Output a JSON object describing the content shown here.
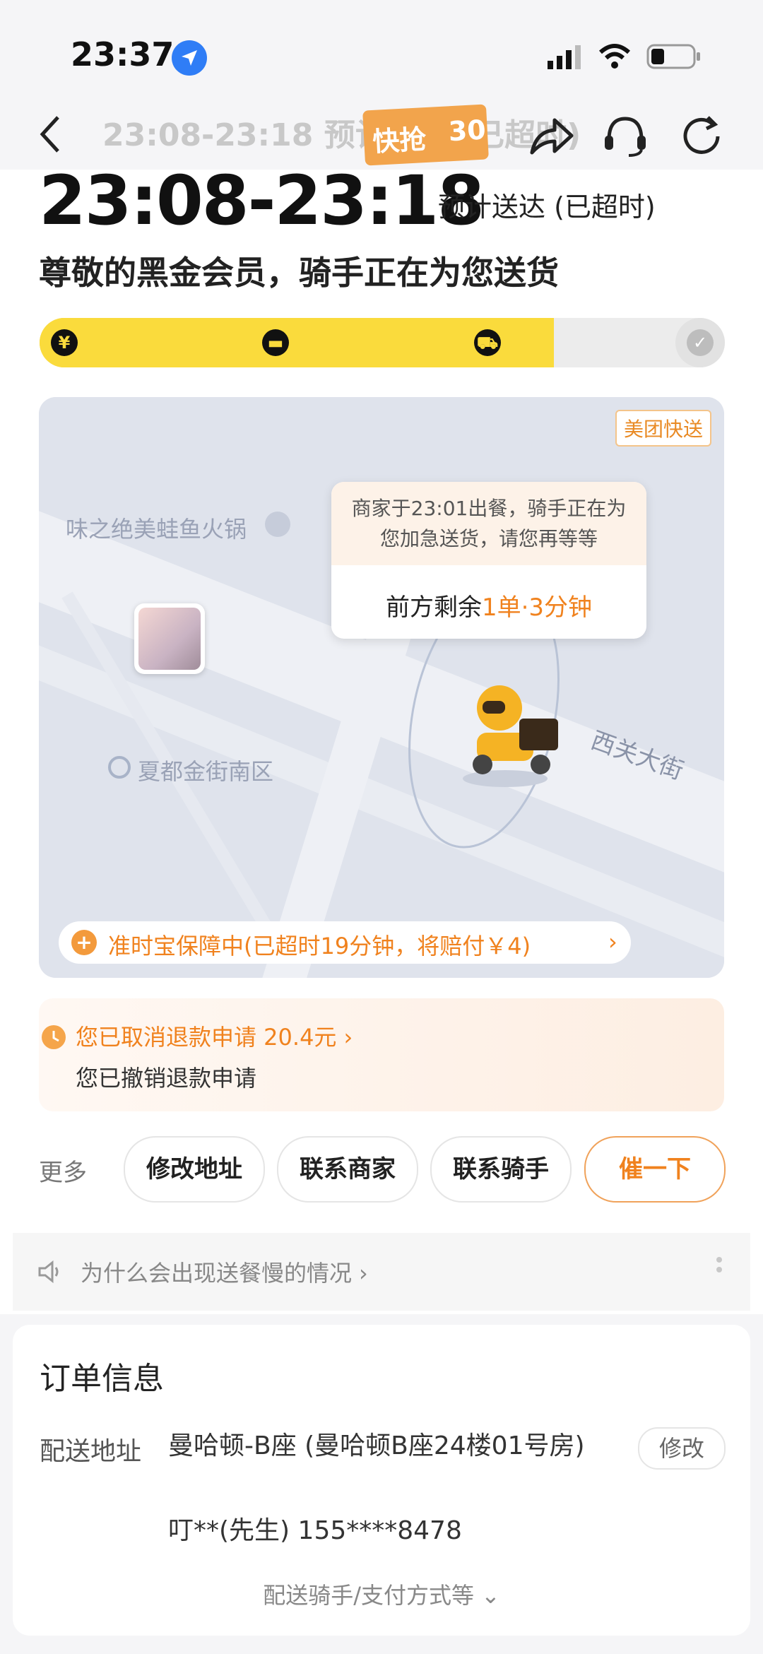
{
  "status_bar": {
    "time": "23:37"
  },
  "header": {
    "title": "23:08-23:18 预计送达 (已超时)",
    "promo_label": "快抢",
    "promo_number": "30"
  },
  "delivery": {
    "time_window": "23:08-23:18",
    "eta_label": "预计送达 (已超时)",
    "member_message": "尊敬的黑金会员，骑手正在为您送货",
    "progress": 0.75
  },
  "map": {
    "tag": "美团快送",
    "poi_restaurant": "味之绝美蛙鱼火锅",
    "poi_area": "夏都金街南区",
    "street": "西关大街",
    "bubble_message": "商家于23:01出餐，骑手正在为您加急送货，请您再等等",
    "bubble_remain_prefix": "前方剩余",
    "bubble_remain_value": "1单·3分钟",
    "guarantee": "准时宝保障中(已超时19分钟，将赔付￥4)"
  },
  "refund": {
    "title": "您已取消退款申请  20.4元",
    "subtitle": "您已撤销退款申请"
  },
  "actions": {
    "more_label": "更多",
    "buttons": [
      "修改地址",
      "联系商家",
      "联系骑手",
      "催一下"
    ]
  },
  "tip": {
    "text": "为什么会出现送餐慢的情况"
  },
  "order": {
    "title": "订单信息",
    "address_label": "配送地址",
    "address": "曼哈顿-B座 (曼哈顿B座24楼01号房)",
    "contact": "叮**(先生) 155****8478",
    "edit_label": "修改",
    "footer": "配送骑手/支付方式等"
  },
  "colors": {
    "accent": "#f0821e",
    "progress_yellow": "#fadb3c",
    "loc_blue": "#2f7df6"
  }
}
